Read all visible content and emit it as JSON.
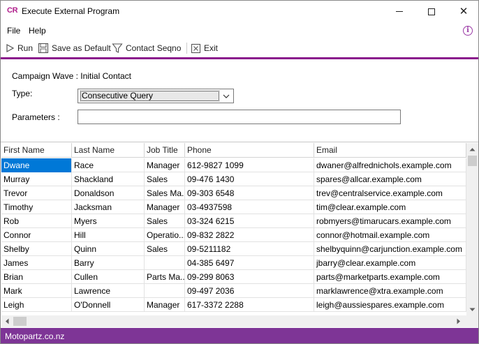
{
  "window": {
    "logo": "CR",
    "title": "Execute External Program"
  },
  "menu": {
    "file": "File",
    "help": "Help"
  },
  "toolbar": {
    "run": "Run",
    "save_default": "Save as Default",
    "contact_seqno": "Contact Seqno",
    "exit": "Exit"
  },
  "form": {
    "campaign_wave": "Campaign Wave : Initial Contact",
    "type_label": "Type:",
    "type_value": "Consecutive Query",
    "parameters_label": "Parameters :",
    "parameters_value": ""
  },
  "grid": {
    "columns": [
      "First Name",
      "Last Name",
      "Job Title",
      "Phone",
      "Email"
    ],
    "rows": [
      [
        "Dwane",
        "Race",
        "Manager",
        "612-9827 1099",
        "dwaner@alfrednichols.example.com"
      ],
      [
        "Murray",
        "Shackland",
        "Sales",
        "09-476 1430",
        "spares@allcar.example.com"
      ],
      [
        "Trevor",
        "Donaldson",
        "Sales Ma...",
        "09-303 6548",
        "trev@centralservice.example.com"
      ],
      [
        "Timothy",
        "Jacksman",
        "Manager",
        "03-4937598",
        "tim@clear.example.com"
      ],
      [
        "Rob",
        "Myers",
        "Sales",
        "03-324 6215",
        "robmyers@timarucars.example.com"
      ],
      [
        "Connor",
        "Hill",
        "Operatio...",
        "09-832 2822",
        "connor@hotmail.example.com"
      ],
      [
        "Shelby",
        "Quinn",
        "Sales",
        "09-5211182",
        "shelbyquinn@carjunction.example.com"
      ],
      [
        "James",
        "Barry",
        "",
        "04-385 6497",
        "jbarry@clear.example.com"
      ],
      [
        "Brian",
        "Cullen",
        "Parts Ma...",
        "09-299 8063",
        "parts@marketparts.example.com"
      ],
      [
        "Mark",
        "Lawrence",
        "",
        "09-497 2036",
        "marklawrence@xtra.example.com"
      ],
      [
        "Leigh",
        "O'Donnell",
        "Manager",
        "617-3372 2288",
        "leigh@aussiespares.example.com"
      ]
    ]
  },
  "status": {
    "text": "Motopartz.co.nz"
  },
  "colors": {
    "accent": "#8a1a8c",
    "status_bar": "#7e3596",
    "selection": "#0078d7"
  }
}
